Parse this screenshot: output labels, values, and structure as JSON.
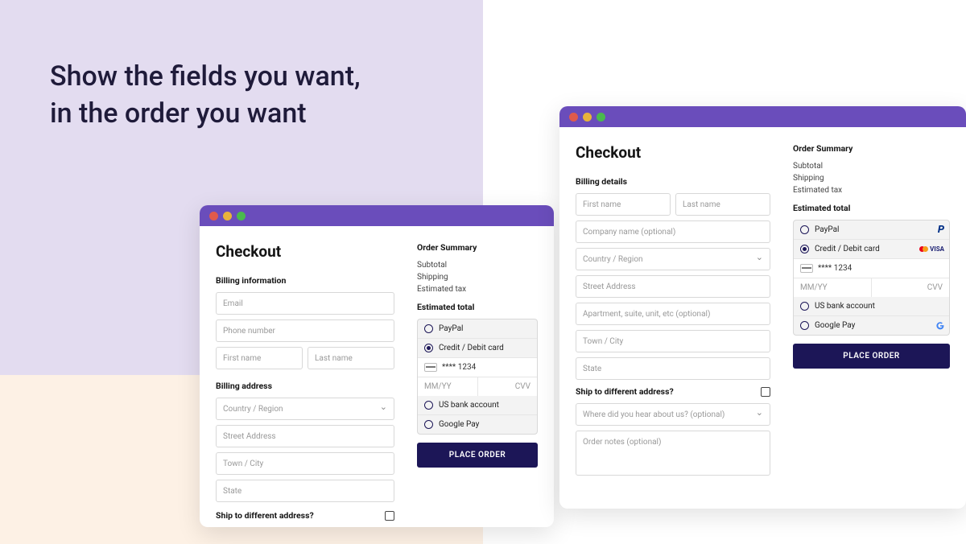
{
  "headline_l1": "Show the fields you want,",
  "headline_l2": "in the order you want",
  "windowA": {
    "title": "Checkout",
    "section1": "Billing information",
    "fields1": {
      "email": "Email",
      "phone": "Phone number",
      "first": "First name",
      "last": "Last name"
    },
    "section2": "Billing address",
    "fields2": {
      "country": "Country / Region",
      "street": "Street Address",
      "city": "Town / City",
      "state": "State"
    },
    "ship_label": "Ship to different address?",
    "summary": {
      "title": "Order Summary",
      "subtotal": "Subtotal",
      "shipping": "Shipping",
      "tax": "Estimated tax",
      "total": "Estimated total"
    },
    "payments": {
      "paypal": "PayPal",
      "card": "Credit / Debit card",
      "card_num": "**** 1234",
      "exp": "MM/YY",
      "cvv": "CVV",
      "bank": "US bank account",
      "gpay": "Google Pay"
    },
    "place_order": "PLACE ORDER"
  },
  "windowB": {
    "title": "Checkout",
    "section1": "Billing details",
    "fields": {
      "first": "First name",
      "last": "Last name",
      "company": "Company name (optional)",
      "country": "Country / Region",
      "street": "Street Address",
      "apt": "Apartment, suite, unit, etc (optional)",
      "city": "Town / City",
      "state": "State",
      "hear": "Where did you hear about us? (optional)",
      "notes": "Order notes (optional)"
    },
    "ship_label": "Ship to different address?",
    "summary": {
      "title": "Order Summary",
      "subtotal": "Subtotal",
      "shipping": "Shipping",
      "tax": "Estimated tax",
      "total": "Estimated total"
    },
    "payments": {
      "paypal": "PayPal",
      "card": "Credit / Debit card",
      "card_num": "**** 1234",
      "exp": "MM/YY",
      "cvv": "CVV",
      "bank": "US bank account",
      "gpay": "Google Pay"
    },
    "place_order": "PLACE ORDER"
  }
}
